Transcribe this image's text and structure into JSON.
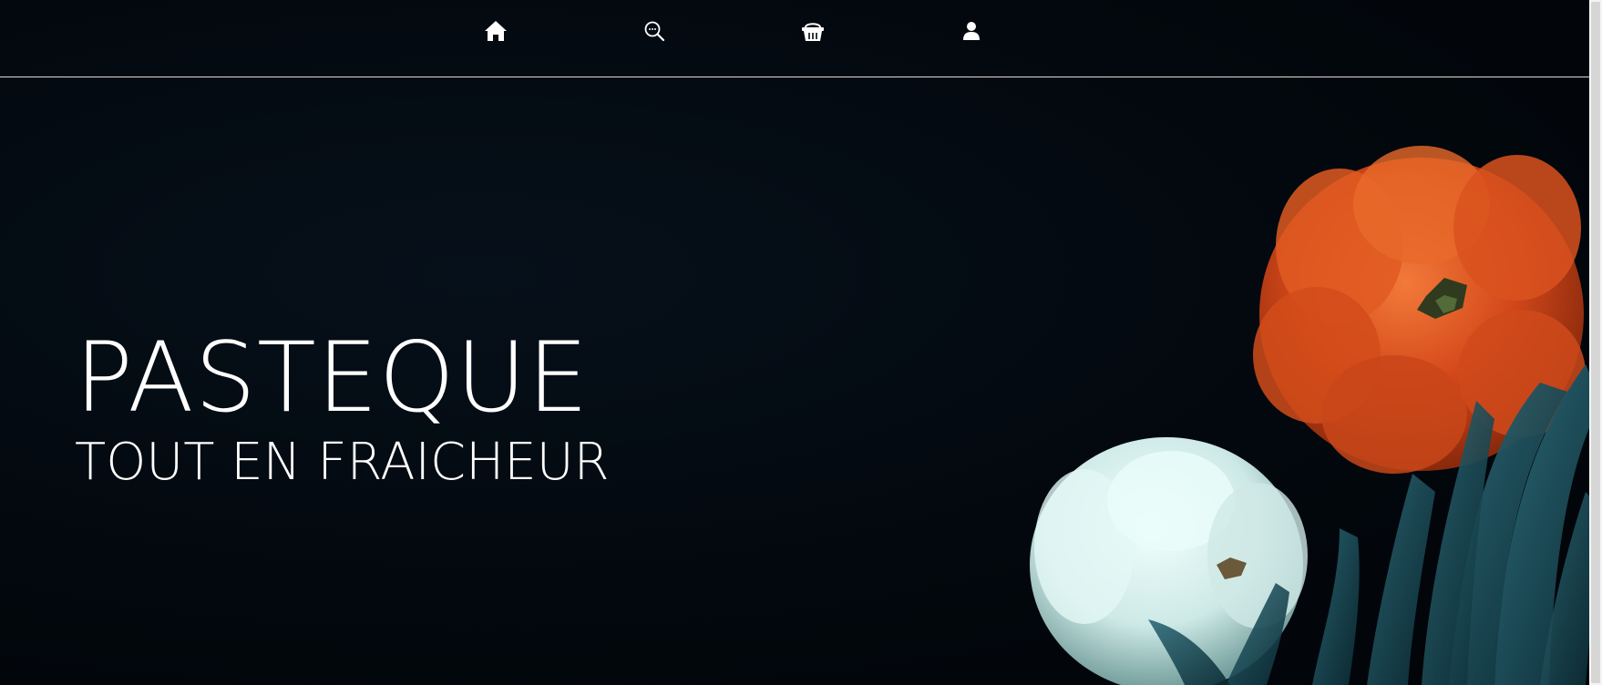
{
  "nav": {
    "items": [
      {
        "icon": "home-icon"
      },
      {
        "icon": "search-icon"
      },
      {
        "icon": "basket-icon"
      },
      {
        "icon": "user-icon"
      }
    ]
  },
  "hero": {
    "title": "PASTEQUE",
    "subtitle": "TOUT EN FRAICHEUR",
    "image": "pumpkins-and-pineapple-leaves"
  },
  "colors": {
    "background": "#02070c",
    "text": "#ffffff",
    "orange_pumpkin": "#e0531c",
    "white_pumpkin": "#d8f0ee",
    "leaves": "#1d4a55"
  }
}
